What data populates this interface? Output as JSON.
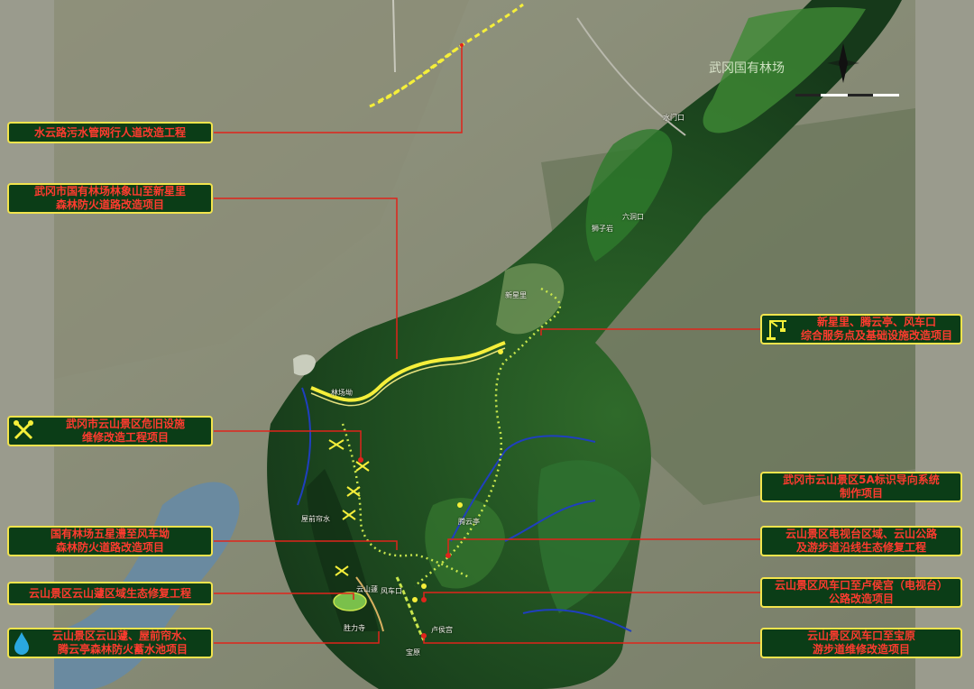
{
  "map": {
    "forest_name": "武冈国有林场",
    "colors": {
      "label_bg": "#0b3d17",
      "label_border": "#f2e44d",
      "label_text": "#ff3b2f",
      "leader_line": "#e0241b",
      "road_highlight": "#f5ef3a",
      "trail_dotted": "#c8e64c",
      "river": "#1f3fbf"
    },
    "labels": [
      {
        "id": "shuiyun",
        "lines": [
          "水云路污水管网行人道改造工程"
        ],
        "icon": ""
      },
      {
        "id": "guoyou-fire-road",
        "lines": [
          "武冈市国有林场林象山至新星里",
          "森林防火道路改造项目"
        ],
        "icon": ""
      },
      {
        "id": "weijiu",
        "lines": [
          "武冈市云山景区危旧设施",
          "维修改造工程项目"
        ],
        "icon": "wrench-icon"
      },
      {
        "id": "wuxing-fengche",
        "lines": [
          "国有林场五星澧至风车坳",
          "森林防火道路改造项目"
        ],
        "icon": ""
      },
      {
        "id": "yunshantai-eco",
        "lines": [
          "云山景区云山蘧区域生态修复工程"
        ],
        "icon": ""
      },
      {
        "id": "water-pool",
        "lines": [
          "云山景区云山蘧、屋前帘水、",
          "腾云亭森林防火蓄水池项目"
        ],
        "icon": "water-drop-icon"
      },
      {
        "id": "service-point",
        "lines": [
          "新星里、腾云亭、风车口",
          "综合服务点及基础设施改造项目"
        ],
        "icon": "crane-icon"
      },
      {
        "id": "signage",
        "lines": [
          "武冈市云山景区5A标识导向系统",
          "制作项目"
        ],
        "icon": ""
      },
      {
        "id": "tv-eco",
        "lines": [
          "云山景区电视台区域、云山公路",
          "及游步道沿线生态修复工程"
        ],
        "icon": ""
      },
      {
        "id": "fengche-lugong",
        "lines": [
          "云山景区风车口至卢侯宫（电视台）",
          "公路改造项目"
        ],
        "icon": ""
      },
      {
        "id": "fengche-baoyuan",
        "lines": [
          "云山景区风车口至宝原",
          "游步道维修改造项目"
        ],
        "icon": ""
      }
    ],
    "places": [
      "新星里",
      "腾云亭",
      "林场坳",
      "风车口",
      "屋前帘水",
      "胜力寺",
      "宝原",
      "卢侯宫",
      "狮子岩",
      "云山蘧",
      "六洞口",
      "水门口"
    ]
  }
}
